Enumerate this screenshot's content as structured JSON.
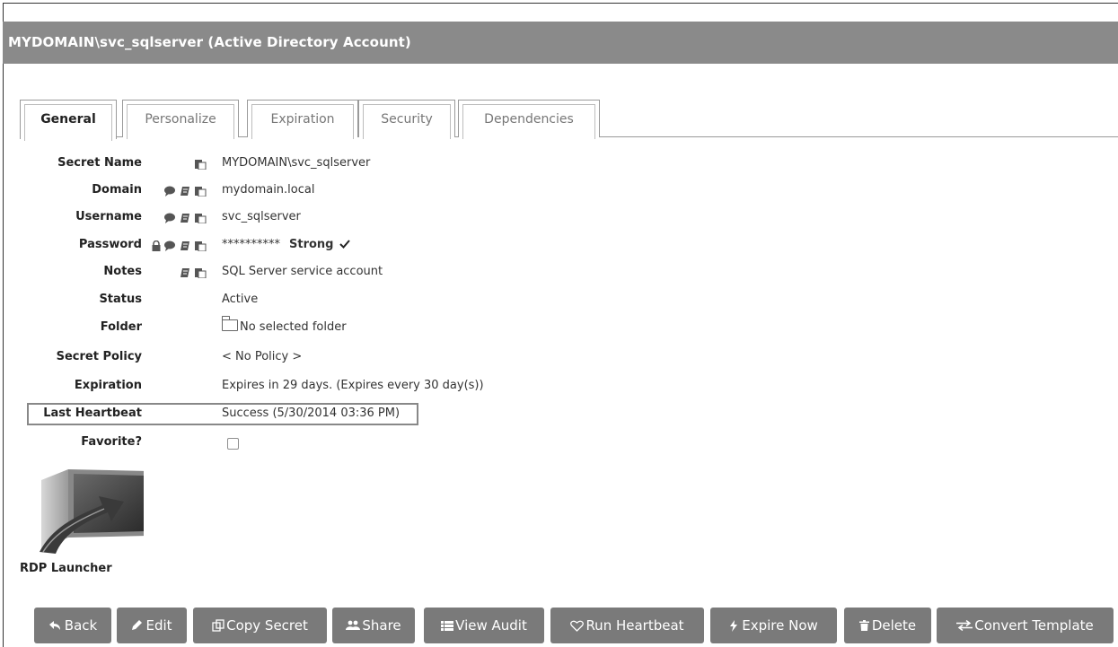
{
  "window": {
    "title": "MYDOMAIN\\svc_sqlserver (Active Directory Account)"
  },
  "tabs": [
    {
      "label": "General",
      "active": true
    },
    {
      "label": "Personalize",
      "active": false
    },
    {
      "label": "Expiration",
      "active": false
    },
    {
      "label": "Security",
      "active": false
    },
    {
      "label": "Dependencies",
      "active": false
    }
  ],
  "fields": {
    "secret_name": {
      "label": "Secret Name",
      "value": "MYDOMAIN\\svc_sqlserver",
      "icons": [
        "copy-icon"
      ]
    },
    "domain": {
      "label": "Domain",
      "value": "mydomain.local",
      "icons": [
        "comment-icon",
        "edit-icon",
        "copy-icon"
      ]
    },
    "username": {
      "label": "Username",
      "value": "svc_sqlserver",
      "icons": [
        "comment-icon",
        "edit-icon",
        "copy-icon"
      ]
    },
    "password": {
      "label": "Password",
      "value": "**********",
      "strength": "Strong",
      "strength_icon": "checkmark-icon",
      "icons": [
        "lock-icon",
        "comment-icon",
        "edit-icon",
        "copy-icon"
      ]
    },
    "notes": {
      "label": "Notes",
      "value": "SQL Server service account",
      "icons": [
        "edit-icon",
        "copy-icon"
      ]
    },
    "status": {
      "label": "Status",
      "value": "Active"
    },
    "folder": {
      "label": "Folder",
      "value": "No selected folder",
      "icon": "folder-icon"
    },
    "secret_policy": {
      "label": "Secret Policy",
      "value": "< No Policy >"
    },
    "expiration": {
      "label": "Expiration",
      "value": "Expires in 29 days. (Expires every 30 day(s))"
    },
    "last_heartbeat": {
      "label": "Last Heartbeat",
      "value": "Success (5/30/2014 03:36 PM)"
    },
    "favorite": {
      "label": "Favorite?",
      "checked": false
    }
  },
  "launcher": {
    "label": "RDP Launcher",
    "icon": "rdp-launcher-icon"
  },
  "buttons": [
    {
      "label": "Back",
      "icon": "back-arrow-icon"
    },
    {
      "label": "Edit",
      "icon": "pencil-icon"
    },
    {
      "label": "Copy Secret",
      "icon": "copy-secret-icon"
    },
    {
      "label": "Share",
      "icon": "users-icon"
    },
    {
      "label": "View Audit",
      "icon": "list-icon"
    },
    {
      "label": "Run Heartbeat",
      "icon": "heart-icon"
    },
    {
      "label": "Expire Now",
      "icon": "lightning-icon"
    },
    {
      "label": "Delete",
      "icon": "trash-icon"
    },
    {
      "label": "Convert Template",
      "icon": "exchange-icon"
    }
  ],
  "colors": {
    "titlebar_bg": "#8a8a8a",
    "button_bg": "#7a7a7a",
    "text": "#222222"
  }
}
